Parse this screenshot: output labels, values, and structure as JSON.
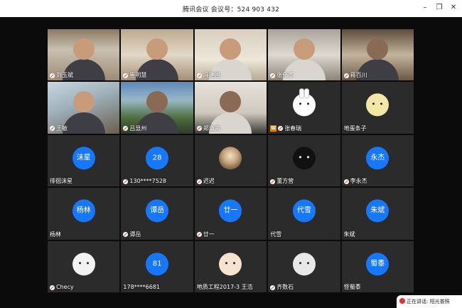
{
  "window": {
    "title": "腾讯会议  会议号：524 903 432",
    "controls": [
      "minimize-icon",
      "restore-icon",
      "close-icon"
    ]
  },
  "participants": [
    {
      "name": "刘玉斌",
      "type": "video",
      "variant": "v1",
      "mic_muted": true
    },
    {
      "name": "崔明慧",
      "type": "video",
      "variant": "v2",
      "mic_muted": true
    },
    {
      "name": "冯建国",
      "type": "video",
      "variant": "v3",
      "mic_muted": true
    },
    {
      "name": "张伟杰",
      "type": "video",
      "variant": "v4",
      "mic_muted": true
    },
    {
      "name": "蒋百川",
      "type": "video",
      "variant": "v5",
      "mic_muted": true
    },
    {
      "name": "王敏",
      "type": "video",
      "variant": "v6",
      "mic_muted": true
    },
    {
      "name": "吕显州",
      "type": "video",
      "variant": "v7",
      "mic_muted": true
    },
    {
      "name": "郑清海",
      "type": "video",
      "variant": "v8",
      "mic_muted": true
    },
    {
      "name": "张春瑞",
      "type": "avatar",
      "avatar": "bunny",
      "phone": true,
      "mic_muted": true
    },
    {
      "name": "地蛋条子",
      "type": "avatar",
      "avatar": "duck",
      "mic_muted": false
    },
    {
      "name": "徘徊沫星",
      "type": "avatar",
      "avatar_text": "沫星",
      "mic_muted": false
    },
    {
      "name": "130****7528",
      "type": "avatar",
      "avatar_text": "28",
      "mic_muted": true
    },
    {
      "name": "迟迟",
      "type": "avatar",
      "avatar": "dark-photo",
      "mic_muted": true
    },
    {
      "name": "董方营",
      "type": "avatar",
      "avatar": "cat",
      "mic_muted": true
    },
    {
      "name": "李永杰",
      "type": "avatar",
      "avatar_text": "永杰",
      "mic_muted": true
    },
    {
      "name": "杨林",
      "type": "avatar",
      "avatar_text": "杨林",
      "mic_muted": false
    },
    {
      "name": "谭岳",
      "type": "avatar",
      "avatar_text": "谭岳",
      "mic_muted": true
    },
    {
      "name": "廿一",
      "type": "avatar",
      "avatar_text": "廿一",
      "mic_muted": true
    },
    {
      "name": "代雪",
      "type": "avatar",
      "avatar_text": "代雪",
      "mic_muted": false
    },
    {
      "name": "朱斌",
      "type": "avatar",
      "avatar_text": "朱斌",
      "mic_muted": false
    },
    {
      "name": "Checy",
      "type": "avatar",
      "avatar": "white-cartoon",
      "mic_muted": true
    },
    {
      "name": "178****6681",
      "type": "avatar",
      "avatar_text": "81",
      "mic_muted": false
    },
    {
      "name": "地质工程2017-3 王浩",
      "type": "avatar",
      "avatar": "pig",
      "mic_muted": false
    },
    {
      "name": "齐数石",
      "type": "avatar",
      "avatar": "bear-3",
      "mic_muted": true
    },
    {
      "name": "怪蜀黍",
      "type": "avatar",
      "avatar_text": "蜀黍",
      "mic_muted": false
    }
  ],
  "status_bar": {
    "text": "正在讲话: 阳光普照"
  },
  "colors": {
    "avatar_blue": "#1677ff",
    "background": "#0b0b0b",
    "tile": "#2b2b2b"
  }
}
